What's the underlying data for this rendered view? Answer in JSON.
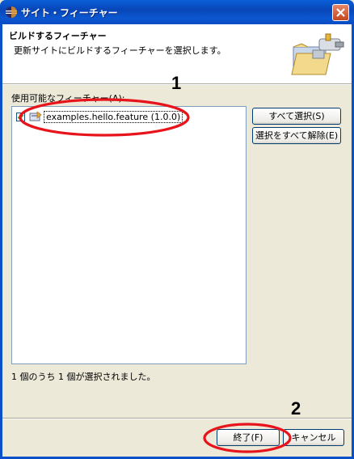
{
  "window": {
    "title": "サイト・フィーチャー",
    "close_symbol": "×"
  },
  "banner": {
    "title": "ビルドするフィーチャー",
    "description": "更新サイトにビルドするフィーチャーを選択します。"
  },
  "features": {
    "label": "使用可能なフィーチャー(A):",
    "items": [
      {
        "label": "examples.hello.feature (1.0.0)",
        "checked": true
      }
    ]
  },
  "buttons": {
    "select_all": "すべて選択(S)",
    "deselect_all": "選択をすべて解除(E)",
    "finish": "終了(F)",
    "cancel": "キャンセル"
  },
  "status": "1 個のうち 1 個が選択されました。",
  "annotations": [
    {
      "number": "1"
    },
    {
      "number": "2"
    }
  ],
  "colors": {
    "titlebar": "#0A5FD8",
    "annotation": "#E8141B",
    "dialog_bg": "#ECE9D8"
  }
}
